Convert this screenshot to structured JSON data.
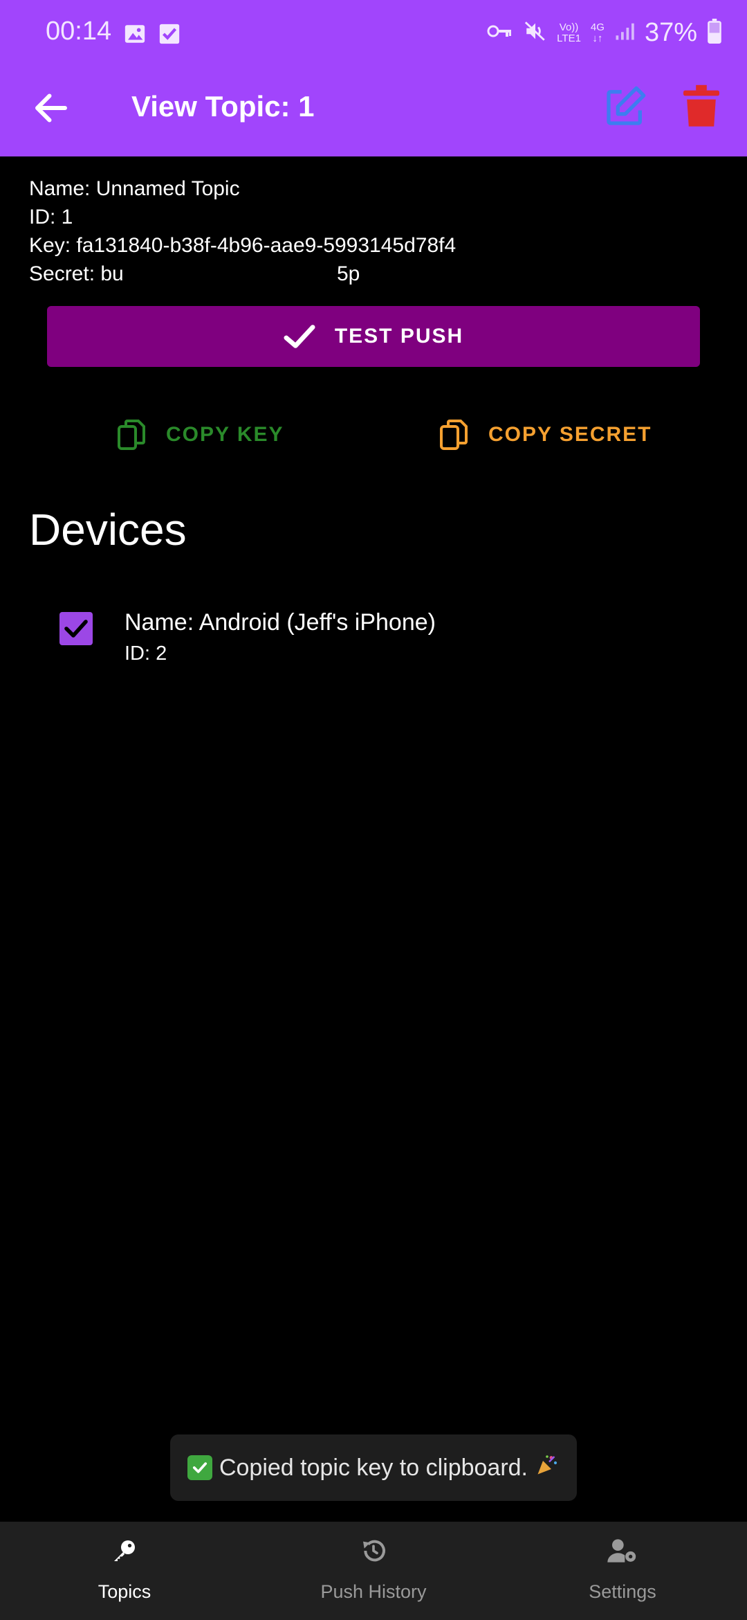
{
  "status_bar": {
    "time": "00:14",
    "battery": "37%",
    "network_label_1": "Vo))",
    "network_label_2": "LTE1",
    "network_label_3": "4G"
  },
  "app_bar": {
    "title": "View Topic: 1",
    "back_icon": "arrow-left-icon",
    "edit_icon": "edit-icon",
    "delete_icon": "trash-icon",
    "edit_color": "#3d7df0",
    "delete_color": "#e02a2a"
  },
  "topic": {
    "name_line": "Name: Unnamed Topic",
    "id_line": "ID: 1",
    "key_line": "Key: fa131840-b38f-4b96-aae9-5993145d78f4",
    "secret_start": "Secret: bu",
    "secret_end": "5p"
  },
  "buttons": {
    "test_push": "TEST PUSH",
    "copy_key": "COPY KEY",
    "copy_secret": "COPY SECRET",
    "test_push_color": "#7f007f",
    "copy_key_color": "#2a8a2a",
    "copy_secret_color": "#f5a030"
  },
  "devices": {
    "title": "Devices",
    "items": [
      {
        "name": "Name: Android (Jeff's iPhone)",
        "id": "ID: 2",
        "checked": true
      }
    ]
  },
  "toast": {
    "text": "Copied topic key to clipboard."
  },
  "bottom_nav": {
    "items": [
      {
        "label": "Topics",
        "icon": "key-icon",
        "active": true
      },
      {
        "label": "Push History",
        "icon": "history-icon",
        "active": false
      },
      {
        "label": "Settings",
        "icon": "user-gear-icon",
        "active": false
      }
    ]
  },
  "colors": {
    "primary": "#a145fc",
    "background": "#000000"
  }
}
